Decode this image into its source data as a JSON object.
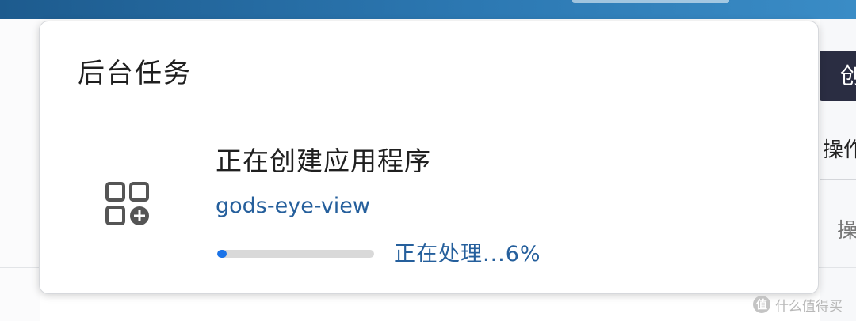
{
  "popover": {
    "title": "后台任务",
    "task": {
      "icon": "apps-add-icon",
      "name": "正在创建应用程序",
      "app_name": "gods-eye-view",
      "progress": 0.06,
      "status": "正在处理...6%"
    }
  },
  "background": {
    "create_button_label": "创",
    "table_header": "操作",
    "table_cell": "操"
  },
  "watermark": {
    "text": "什么值得买",
    "badge": "值"
  },
  "colors": {
    "accent": "#1a73e8",
    "link": "#255f9c",
    "topbar": "#2c78b2"
  }
}
